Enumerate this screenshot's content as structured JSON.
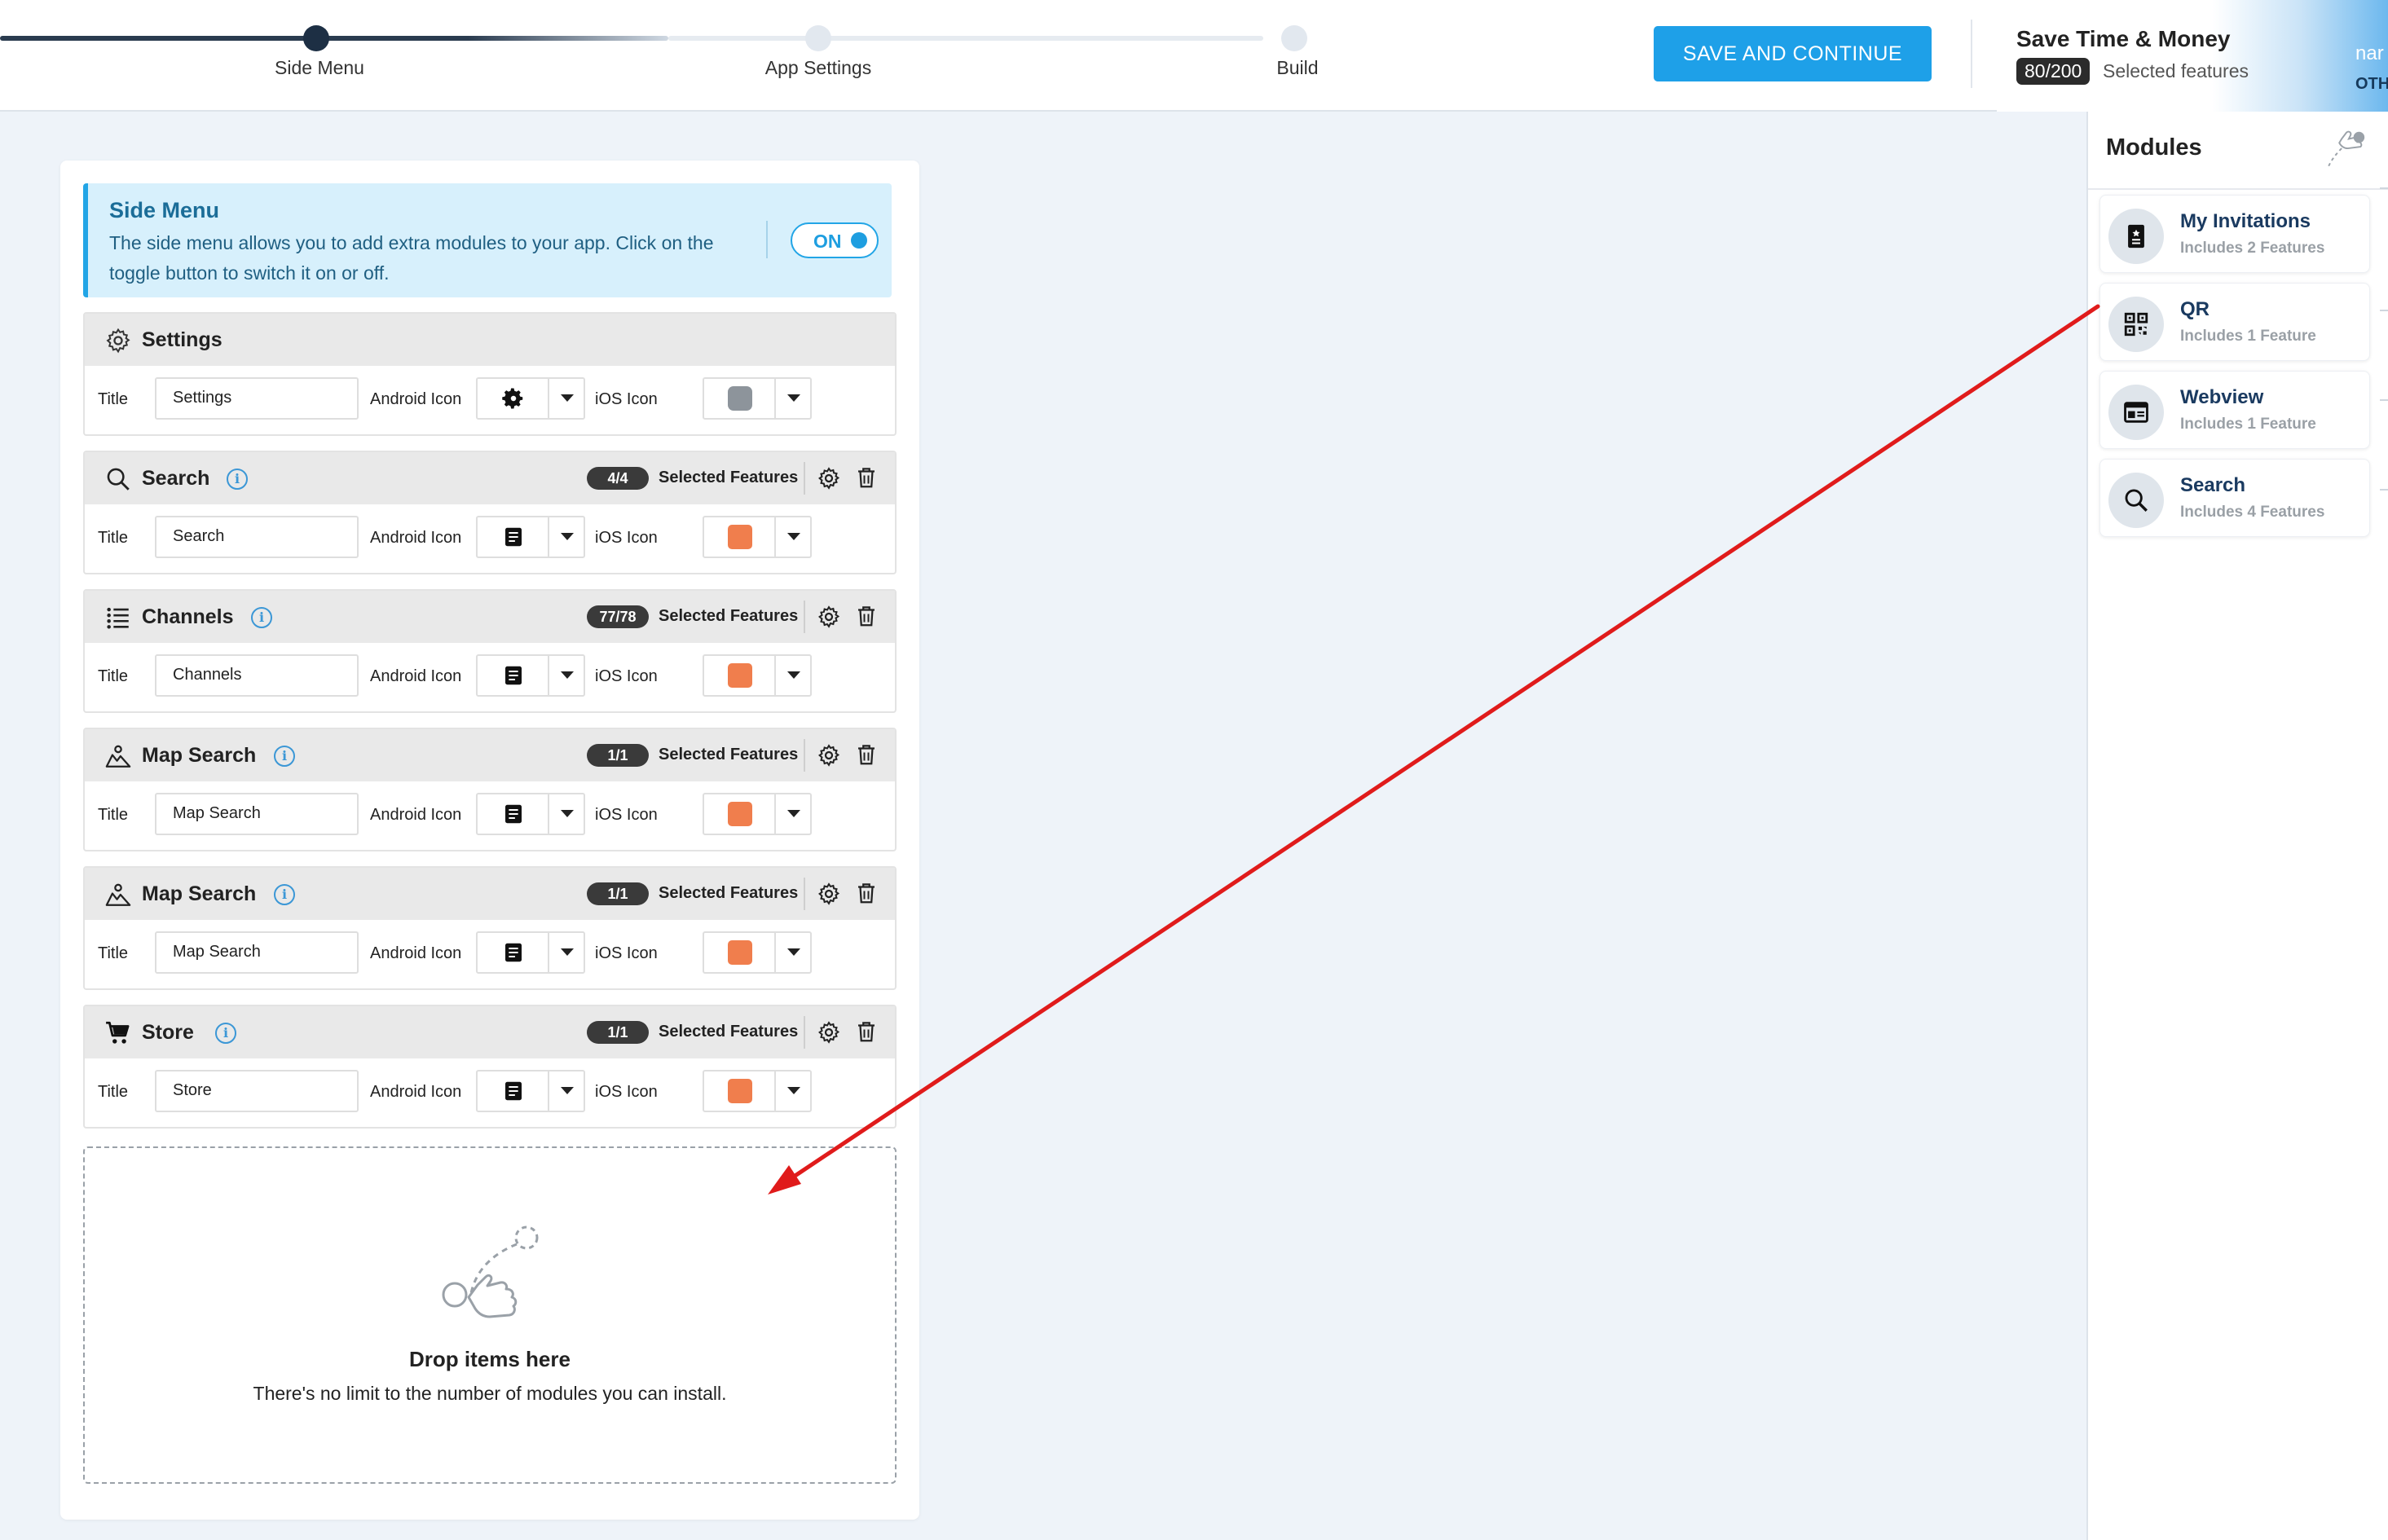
{
  "stepper": {
    "steps": [
      {
        "label": "Side Menu"
      },
      {
        "label": "App Settings"
      },
      {
        "label": "Build"
      }
    ]
  },
  "toolbar": {
    "save_label": "SAVE AND CONTINUE"
  },
  "promo": {
    "title": "Save Time & Money",
    "badge": "80/200",
    "text": "Selected features",
    "cut_text_1": "nar",
    "cut_text_2": "OTH"
  },
  "info": {
    "title": "Side Menu",
    "description": "The side menu allows you to add extra modules to your app. Click on the toggle button to switch it on or off.",
    "toggle_label": "ON"
  },
  "fields": {
    "title_label": "Title",
    "android_label": "Android Icon",
    "ios_label": "iOS Icon"
  },
  "modules": [
    {
      "name": "Settings",
      "title_value": "Settings",
      "icon": "gear-icon",
      "android_icon": "gear-icon",
      "ios_icon": "settings-app-icon"
    },
    {
      "name": "Search",
      "title_value": "Search",
      "icon": "search-icon",
      "badge": "4/4",
      "selected_label": "Selected Features",
      "android_icon": "document-icon",
      "ios_icon": "rss-icon"
    },
    {
      "name": "Channels",
      "title_value": "Channels",
      "icon": "list-icon",
      "badge": "77/78",
      "selected_label": "Selected Features",
      "android_icon": "document-icon",
      "ios_icon": "rss-icon"
    },
    {
      "name": "Map Search",
      "title_value": "Map Search",
      "icon": "map-icon",
      "badge": "1/1",
      "selected_label": "Selected Features",
      "android_icon": "document-icon",
      "ios_icon": "rss-icon"
    },
    {
      "name": "Map Search",
      "title_value": "Map Search",
      "icon": "map-icon",
      "badge": "1/1",
      "selected_label": "Selected Features",
      "android_icon": "document-icon",
      "ios_icon": "rss-icon"
    },
    {
      "name": "Store",
      "title_value": "Store",
      "icon": "cart-icon",
      "badge": "1/1",
      "selected_label": "Selected Features",
      "android_icon": "document-icon",
      "ios_icon": "rss-icon"
    }
  ],
  "dropzone": {
    "title": "Drop items here",
    "description": "There's no limit to the number of modules you can install."
  },
  "sidebar": {
    "title": "Modules",
    "items": [
      {
        "name": "My Invitations",
        "subtitle": "Includes 2 Features",
        "icon": "invitation-icon"
      },
      {
        "name": "QR",
        "subtitle": "Includes 1 Feature",
        "icon": "qr-icon"
      },
      {
        "name": "Webview",
        "subtitle": "Includes 1 Feature",
        "icon": "webview-icon"
      },
      {
        "name": "Search",
        "subtitle": "Includes 4 Features",
        "icon": "search-icon"
      }
    ]
  },
  "colors": {
    "accent": "#1ea0e8",
    "info_bg": "#d7f0fc",
    "rss_orange": "#f07e4d",
    "arrow_red": "#e01b1b",
    "stepper_dark": "#1d2f44"
  }
}
